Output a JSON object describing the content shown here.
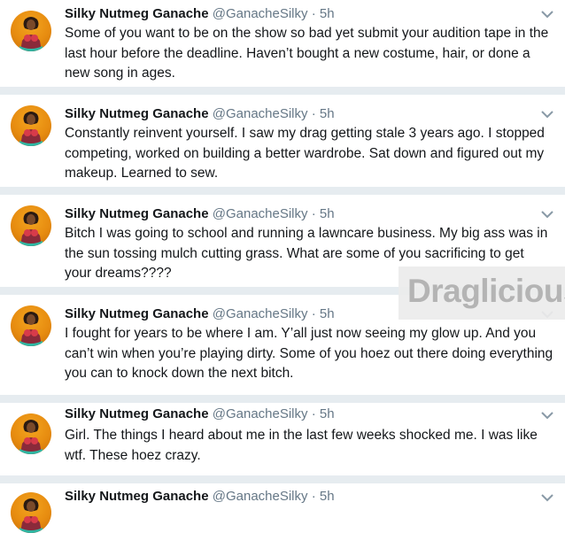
{
  "tweets": [
    {
      "name": "Silky Nutmeg Ganache",
      "handle": "@GanacheSilky",
      "dot": "·",
      "time": "5h",
      "text": "Some of you want to be on the show so bad yet submit your audition tape in the last hour before the deadline. Haven’t bought a new costume, hair, or done a new song in ages."
    },
    {
      "name": "Silky Nutmeg Ganache",
      "handle": "@GanacheSilky",
      "dot": "·",
      "time": "5h",
      "text": "Constantly reinvent yourself. I saw my drag getting stale 3 years ago. I stopped competing, worked on building a better wardrobe. Sat down and figured out my makeup. Learned to sew."
    },
    {
      "name": "Silky Nutmeg Ganache",
      "handle": "@GanacheSilky",
      "dot": "·",
      "time": "5h",
      "text": "Bitch I was going to school and running a lawncare business. My big ass was in the sun tossing mulch cutting grass. What are some of you sacrificing to get your dreams????"
    },
    {
      "name": "Silky Nutmeg Ganache",
      "handle": "@GanacheSilky",
      "dot": "·",
      "time": "5h",
      "text": "I fought for years to be where I am. Y’all just now seeing my glow up. And you can’t win when you’re playing dirty. Some of you hoez out there doing everything you can to knock down the next bitch."
    },
    {
      "name": "Silky Nutmeg Ganache",
      "handle": "@GanacheSilky",
      "dot": "·",
      "time": "5h",
      "text": "Girl. The things I heard about me in the last few weeks shocked me. I was like wtf. These hoez crazy."
    },
    {
      "name": "Silky Nutmeg Ganache",
      "handle": "@GanacheSilky",
      "dot": "·",
      "time": "5h",
      "text": ""
    }
  ],
  "watermark": {
    "text": "Draglicious"
  },
  "colors": {
    "name": "#14171a",
    "meta": "#657786",
    "divider": "#e6ecf0",
    "avatar_bg": "#e78c10"
  },
  "icons": {
    "avatar": "profile-avatar",
    "menu": "chevron-down-icon"
  }
}
